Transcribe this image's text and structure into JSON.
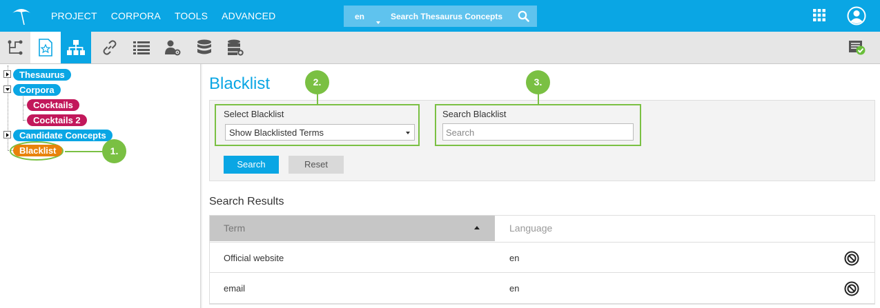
{
  "topbar": {
    "menu": [
      "PROJECT",
      "CORPORA",
      "TOOLS",
      "ADVANCED"
    ],
    "search": {
      "lang": "en",
      "placeholder": "Search Thesaurus Concepts"
    },
    "bg_color": "#0aa6e4"
  },
  "toolbar": {
    "icons": [
      "hierarchy-icon",
      "scheme-star-icon",
      "tree-icon",
      "link-icon",
      "list-icon",
      "user-settings-icon",
      "database-icon",
      "server-settings-icon",
      "status-check-icon"
    ]
  },
  "tree": {
    "thesaurus": "Thesaurus",
    "corpora": "Corpora",
    "cocktails": "Cocktails",
    "cocktails2": "Cocktails 2",
    "candidate": "Candidate Concepts",
    "blacklist": "Blacklist"
  },
  "callouts": {
    "one": "1.",
    "two": "2.",
    "three": "3.",
    "color": "#7ac043"
  },
  "main": {
    "title": "Blacklist",
    "select_label": "Select Blacklist",
    "select_value": "Show Blacklisted Terms",
    "search_label": "Search Blacklist",
    "search_placeholder": "Search",
    "search_button": "Search",
    "reset_button": "Reset",
    "results_label": "Search Results",
    "columns": {
      "term": "Term",
      "language": "Language"
    },
    "rows": [
      {
        "term": "Official website",
        "language": "en"
      },
      {
        "term": "email",
        "language": "en"
      }
    ]
  }
}
